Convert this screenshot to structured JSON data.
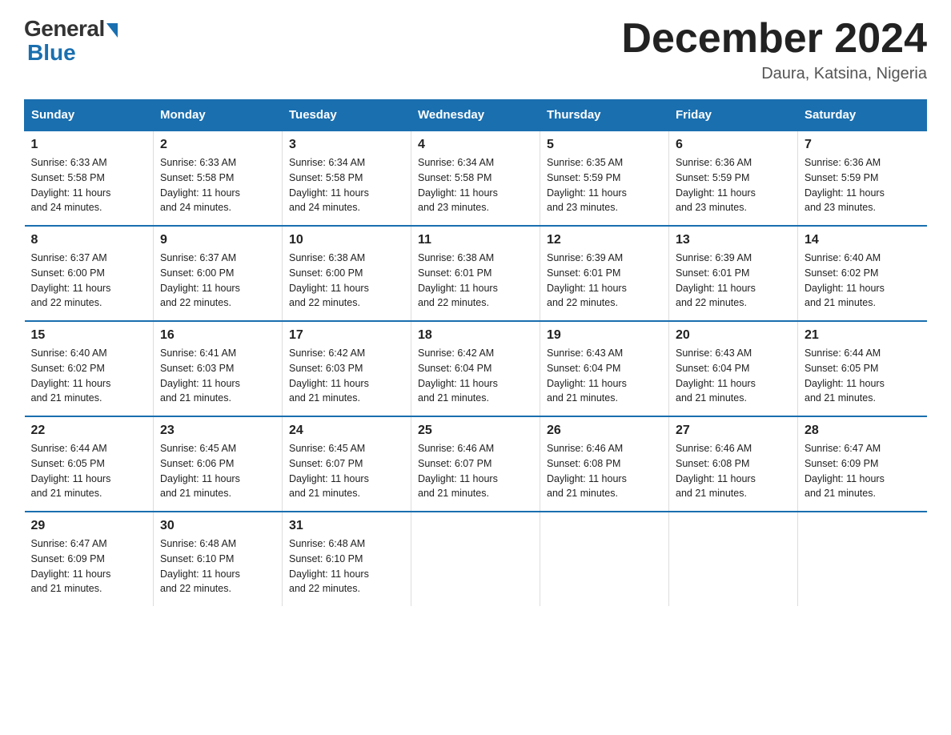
{
  "logo": {
    "general": "General",
    "blue": "Blue"
  },
  "title": "December 2024",
  "location": "Daura, Katsina, Nigeria",
  "days_of_week": [
    "Sunday",
    "Monday",
    "Tuesday",
    "Wednesday",
    "Thursday",
    "Friday",
    "Saturday"
  ],
  "weeks": [
    [
      {
        "day": "1",
        "info": "Sunrise: 6:33 AM\nSunset: 5:58 PM\nDaylight: 11 hours\nand 24 minutes."
      },
      {
        "day": "2",
        "info": "Sunrise: 6:33 AM\nSunset: 5:58 PM\nDaylight: 11 hours\nand 24 minutes."
      },
      {
        "day": "3",
        "info": "Sunrise: 6:34 AM\nSunset: 5:58 PM\nDaylight: 11 hours\nand 24 minutes."
      },
      {
        "day": "4",
        "info": "Sunrise: 6:34 AM\nSunset: 5:58 PM\nDaylight: 11 hours\nand 23 minutes."
      },
      {
        "day": "5",
        "info": "Sunrise: 6:35 AM\nSunset: 5:59 PM\nDaylight: 11 hours\nand 23 minutes."
      },
      {
        "day": "6",
        "info": "Sunrise: 6:36 AM\nSunset: 5:59 PM\nDaylight: 11 hours\nand 23 minutes."
      },
      {
        "day": "7",
        "info": "Sunrise: 6:36 AM\nSunset: 5:59 PM\nDaylight: 11 hours\nand 23 minutes."
      }
    ],
    [
      {
        "day": "8",
        "info": "Sunrise: 6:37 AM\nSunset: 6:00 PM\nDaylight: 11 hours\nand 22 minutes."
      },
      {
        "day": "9",
        "info": "Sunrise: 6:37 AM\nSunset: 6:00 PM\nDaylight: 11 hours\nand 22 minutes."
      },
      {
        "day": "10",
        "info": "Sunrise: 6:38 AM\nSunset: 6:00 PM\nDaylight: 11 hours\nand 22 minutes."
      },
      {
        "day": "11",
        "info": "Sunrise: 6:38 AM\nSunset: 6:01 PM\nDaylight: 11 hours\nand 22 minutes."
      },
      {
        "day": "12",
        "info": "Sunrise: 6:39 AM\nSunset: 6:01 PM\nDaylight: 11 hours\nand 22 minutes."
      },
      {
        "day": "13",
        "info": "Sunrise: 6:39 AM\nSunset: 6:01 PM\nDaylight: 11 hours\nand 22 minutes."
      },
      {
        "day": "14",
        "info": "Sunrise: 6:40 AM\nSunset: 6:02 PM\nDaylight: 11 hours\nand 21 minutes."
      }
    ],
    [
      {
        "day": "15",
        "info": "Sunrise: 6:40 AM\nSunset: 6:02 PM\nDaylight: 11 hours\nand 21 minutes."
      },
      {
        "day": "16",
        "info": "Sunrise: 6:41 AM\nSunset: 6:03 PM\nDaylight: 11 hours\nand 21 minutes."
      },
      {
        "day": "17",
        "info": "Sunrise: 6:42 AM\nSunset: 6:03 PM\nDaylight: 11 hours\nand 21 minutes."
      },
      {
        "day": "18",
        "info": "Sunrise: 6:42 AM\nSunset: 6:04 PM\nDaylight: 11 hours\nand 21 minutes."
      },
      {
        "day": "19",
        "info": "Sunrise: 6:43 AM\nSunset: 6:04 PM\nDaylight: 11 hours\nand 21 minutes."
      },
      {
        "day": "20",
        "info": "Sunrise: 6:43 AM\nSunset: 6:04 PM\nDaylight: 11 hours\nand 21 minutes."
      },
      {
        "day": "21",
        "info": "Sunrise: 6:44 AM\nSunset: 6:05 PM\nDaylight: 11 hours\nand 21 minutes."
      }
    ],
    [
      {
        "day": "22",
        "info": "Sunrise: 6:44 AM\nSunset: 6:05 PM\nDaylight: 11 hours\nand 21 minutes."
      },
      {
        "day": "23",
        "info": "Sunrise: 6:45 AM\nSunset: 6:06 PM\nDaylight: 11 hours\nand 21 minutes."
      },
      {
        "day": "24",
        "info": "Sunrise: 6:45 AM\nSunset: 6:07 PM\nDaylight: 11 hours\nand 21 minutes."
      },
      {
        "day": "25",
        "info": "Sunrise: 6:46 AM\nSunset: 6:07 PM\nDaylight: 11 hours\nand 21 minutes."
      },
      {
        "day": "26",
        "info": "Sunrise: 6:46 AM\nSunset: 6:08 PM\nDaylight: 11 hours\nand 21 minutes."
      },
      {
        "day": "27",
        "info": "Sunrise: 6:46 AM\nSunset: 6:08 PM\nDaylight: 11 hours\nand 21 minutes."
      },
      {
        "day": "28",
        "info": "Sunrise: 6:47 AM\nSunset: 6:09 PM\nDaylight: 11 hours\nand 21 minutes."
      }
    ],
    [
      {
        "day": "29",
        "info": "Sunrise: 6:47 AM\nSunset: 6:09 PM\nDaylight: 11 hours\nand 21 minutes."
      },
      {
        "day": "30",
        "info": "Sunrise: 6:48 AM\nSunset: 6:10 PM\nDaylight: 11 hours\nand 22 minutes."
      },
      {
        "day": "31",
        "info": "Sunrise: 6:48 AM\nSunset: 6:10 PM\nDaylight: 11 hours\nand 22 minutes."
      },
      {
        "day": "",
        "info": ""
      },
      {
        "day": "",
        "info": ""
      },
      {
        "day": "",
        "info": ""
      },
      {
        "day": "",
        "info": ""
      }
    ]
  ]
}
